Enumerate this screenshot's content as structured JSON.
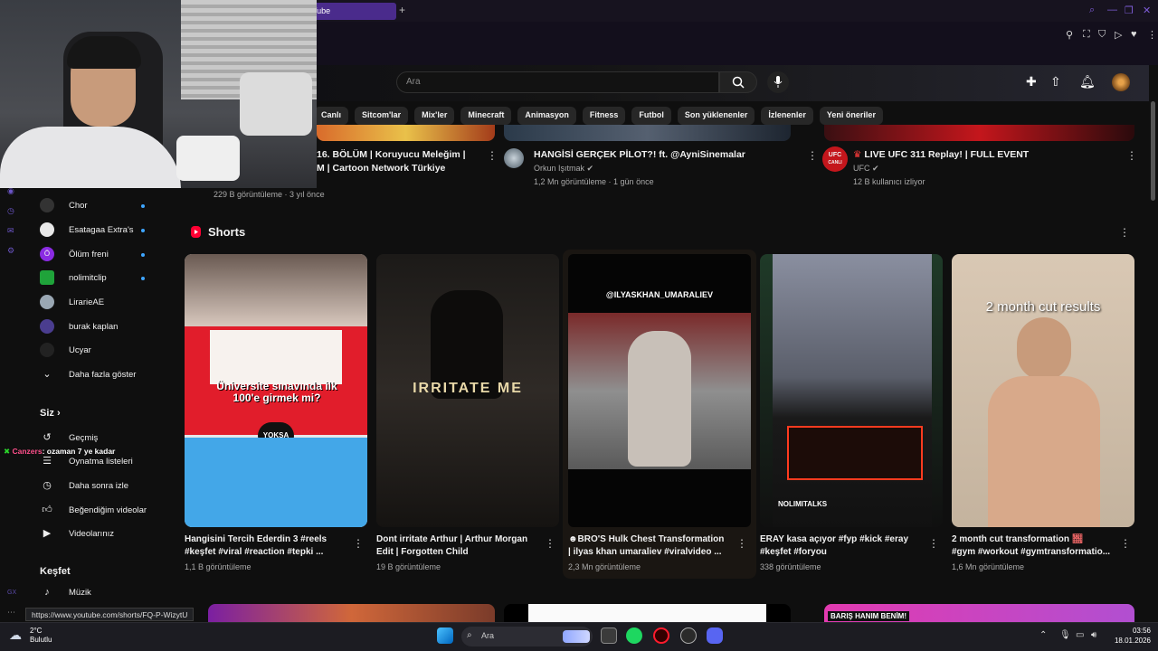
{
  "browser": {
    "tab_title": "Tube",
    "new_tab": "+"
  },
  "search": {
    "placeholder": "Ara"
  },
  "chips": [
    "Canlı",
    "Sitcom'lar",
    "Mix'ler",
    "Minecraft",
    "Animasyon",
    "Fitness",
    "Futbol",
    "Son yüklenenler",
    "İzlenenler",
    "Yeni öneriler"
  ],
  "top_videos": [
    {
      "title_line1": "16. BÖLÜM | Koruyucu Meleğim |",
      "title_line2": "M |  Cartoon Network Türkiye",
      "meta": "229 B görüntüleme · 3 yıl önce"
    },
    {
      "title_line1": "HANGİSİ GERÇEK PİLOT?! ft. @AyniSinemalar",
      "channel": "Orkun Işıtmak",
      "meta": "1,2 Mn görüntüleme · 1 gün önce"
    },
    {
      "title_line1": "LIVE  UFC 311 Replay! | FULL EVENT",
      "channel": "UFC",
      "channel_avatar_text": "UFC",
      "live_label": "CANLI",
      "meta": "12 B kullanıcı izliyor"
    }
  ],
  "sidebar": {
    "subscriptions": [
      {
        "label": "Chor",
        "live": true
      },
      {
        "label": "Esatagaa Extra's",
        "live": true
      },
      {
        "label": "Ölüm freni",
        "live": true
      },
      {
        "label": "nolimitclip",
        "live": true
      },
      {
        "label": "LirarieAE",
        "live": false
      },
      {
        "label": "burak kaplan",
        "live": false
      },
      {
        "label": "Ucyar",
        "live": false
      }
    ],
    "show_more": "Daha fazla göster",
    "you_heading": "Siz",
    "you_items": [
      "Geçmiş",
      "Oynatma listeleri",
      "Daha sonra izle",
      "Beğendiğim videolar",
      "Videolarınız"
    ],
    "explore_heading": "Keşfet",
    "explore_items": [
      "Müzik"
    ]
  },
  "chat": {
    "user": "Canzers",
    "message": ": ozaman 7 ye kadar"
  },
  "shorts": {
    "heading": "Shorts",
    "items": [
      {
        "title_line1": "Hangisini Tercih Ederdin 3 #reels",
        "title_line2": "#keşfet #viral #reaction #tepki ...",
        "views": "1,1 B görüntüleme",
        "overlay_text": "Üniversite sınavında ilk 100'e girmek mi?",
        "overlay_badge": "YOKSA"
      },
      {
        "title_line1": "Dont irritate Arthur | Arthur Morgan",
        "title_line2": "Edit | Forgotten Child",
        "views": "19 B görüntüleme",
        "overlay_text": "IRRITATE ME"
      },
      {
        "title_line1": "BRO'S Hulk Chest Transformation",
        "title_line2": "| ilyas khan umaraliev #viralvideo ...",
        "views": "2,3 Mn görüntüleme",
        "overlay_text": "@ILYASKHAN_UMARALIEV"
      },
      {
        "title_line1": "ERAY kasa açıyor #fyp #kick #eray",
        "title_line2": "#keşfet #foryou",
        "views": "338 görüntüleme",
        "overlay_text": "NOLIMITALKS"
      },
      {
        "title_line1": "2 month cut transformation",
        "title_line2": "#gym #workout #gymtransformatio...",
        "views": "1,6 Mn görüntüleme",
        "overlay_text": "2 month cut results"
      }
    ]
  },
  "bottom_banner": "BARIŞ HANIM BENİM!",
  "status_url": "https://www.youtube.com/shorts/FQ-P-WizytU",
  "taskbar": {
    "search_placeholder": "Ara",
    "weather_temp": "2°C",
    "weather_desc": "Bulutlu",
    "time": "03:56",
    "date": "18.01.2026"
  },
  "colors": {
    "accent": "#6b55c7",
    "live_red": "#ff0033",
    "chip_bg": "#272727"
  }
}
